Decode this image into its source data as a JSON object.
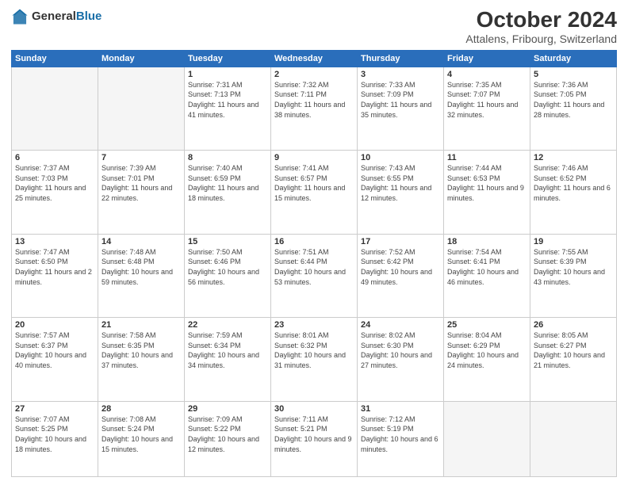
{
  "header": {
    "logo_general": "General",
    "logo_blue": "Blue",
    "month_title": "October 2024",
    "location": "Attalens, Fribourg, Switzerland"
  },
  "weekdays": [
    "Sunday",
    "Monday",
    "Tuesday",
    "Wednesday",
    "Thursday",
    "Friday",
    "Saturday"
  ],
  "weeks": [
    [
      {
        "day": "",
        "info": ""
      },
      {
        "day": "",
        "info": ""
      },
      {
        "day": "1",
        "info": "Sunrise: 7:31 AM\nSunset: 7:13 PM\nDaylight: 11 hours and 41 minutes."
      },
      {
        "day": "2",
        "info": "Sunrise: 7:32 AM\nSunset: 7:11 PM\nDaylight: 11 hours and 38 minutes."
      },
      {
        "day": "3",
        "info": "Sunrise: 7:33 AM\nSunset: 7:09 PM\nDaylight: 11 hours and 35 minutes."
      },
      {
        "day": "4",
        "info": "Sunrise: 7:35 AM\nSunset: 7:07 PM\nDaylight: 11 hours and 32 minutes."
      },
      {
        "day": "5",
        "info": "Sunrise: 7:36 AM\nSunset: 7:05 PM\nDaylight: 11 hours and 28 minutes."
      }
    ],
    [
      {
        "day": "6",
        "info": "Sunrise: 7:37 AM\nSunset: 7:03 PM\nDaylight: 11 hours and 25 minutes."
      },
      {
        "day": "7",
        "info": "Sunrise: 7:39 AM\nSunset: 7:01 PM\nDaylight: 11 hours and 22 minutes."
      },
      {
        "day": "8",
        "info": "Sunrise: 7:40 AM\nSunset: 6:59 PM\nDaylight: 11 hours and 18 minutes."
      },
      {
        "day": "9",
        "info": "Sunrise: 7:41 AM\nSunset: 6:57 PM\nDaylight: 11 hours and 15 minutes."
      },
      {
        "day": "10",
        "info": "Sunrise: 7:43 AM\nSunset: 6:55 PM\nDaylight: 11 hours and 12 minutes."
      },
      {
        "day": "11",
        "info": "Sunrise: 7:44 AM\nSunset: 6:53 PM\nDaylight: 11 hours and 9 minutes."
      },
      {
        "day": "12",
        "info": "Sunrise: 7:46 AM\nSunset: 6:52 PM\nDaylight: 11 hours and 6 minutes."
      }
    ],
    [
      {
        "day": "13",
        "info": "Sunrise: 7:47 AM\nSunset: 6:50 PM\nDaylight: 11 hours and 2 minutes."
      },
      {
        "day": "14",
        "info": "Sunrise: 7:48 AM\nSunset: 6:48 PM\nDaylight: 10 hours and 59 minutes."
      },
      {
        "day": "15",
        "info": "Sunrise: 7:50 AM\nSunset: 6:46 PM\nDaylight: 10 hours and 56 minutes."
      },
      {
        "day": "16",
        "info": "Sunrise: 7:51 AM\nSunset: 6:44 PM\nDaylight: 10 hours and 53 minutes."
      },
      {
        "day": "17",
        "info": "Sunrise: 7:52 AM\nSunset: 6:42 PM\nDaylight: 10 hours and 49 minutes."
      },
      {
        "day": "18",
        "info": "Sunrise: 7:54 AM\nSunset: 6:41 PM\nDaylight: 10 hours and 46 minutes."
      },
      {
        "day": "19",
        "info": "Sunrise: 7:55 AM\nSunset: 6:39 PM\nDaylight: 10 hours and 43 minutes."
      }
    ],
    [
      {
        "day": "20",
        "info": "Sunrise: 7:57 AM\nSunset: 6:37 PM\nDaylight: 10 hours and 40 minutes."
      },
      {
        "day": "21",
        "info": "Sunrise: 7:58 AM\nSunset: 6:35 PM\nDaylight: 10 hours and 37 minutes."
      },
      {
        "day": "22",
        "info": "Sunrise: 7:59 AM\nSunset: 6:34 PM\nDaylight: 10 hours and 34 minutes."
      },
      {
        "day": "23",
        "info": "Sunrise: 8:01 AM\nSunset: 6:32 PM\nDaylight: 10 hours and 31 minutes."
      },
      {
        "day": "24",
        "info": "Sunrise: 8:02 AM\nSunset: 6:30 PM\nDaylight: 10 hours and 27 minutes."
      },
      {
        "day": "25",
        "info": "Sunrise: 8:04 AM\nSunset: 6:29 PM\nDaylight: 10 hours and 24 minutes."
      },
      {
        "day": "26",
        "info": "Sunrise: 8:05 AM\nSunset: 6:27 PM\nDaylight: 10 hours and 21 minutes."
      }
    ],
    [
      {
        "day": "27",
        "info": "Sunrise: 7:07 AM\nSunset: 5:25 PM\nDaylight: 10 hours and 18 minutes."
      },
      {
        "day": "28",
        "info": "Sunrise: 7:08 AM\nSunset: 5:24 PM\nDaylight: 10 hours and 15 minutes."
      },
      {
        "day": "29",
        "info": "Sunrise: 7:09 AM\nSunset: 5:22 PM\nDaylight: 10 hours and 12 minutes."
      },
      {
        "day": "30",
        "info": "Sunrise: 7:11 AM\nSunset: 5:21 PM\nDaylight: 10 hours and 9 minutes."
      },
      {
        "day": "31",
        "info": "Sunrise: 7:12 AM\nSunset: 5:19 PM\nDaylight: 10 hours and 6 minutes."
      },
      {
        "day": "",
        "info": ""
      },
      {
        "day": "",
        "info": ""
      }
    ]
  ]
}
